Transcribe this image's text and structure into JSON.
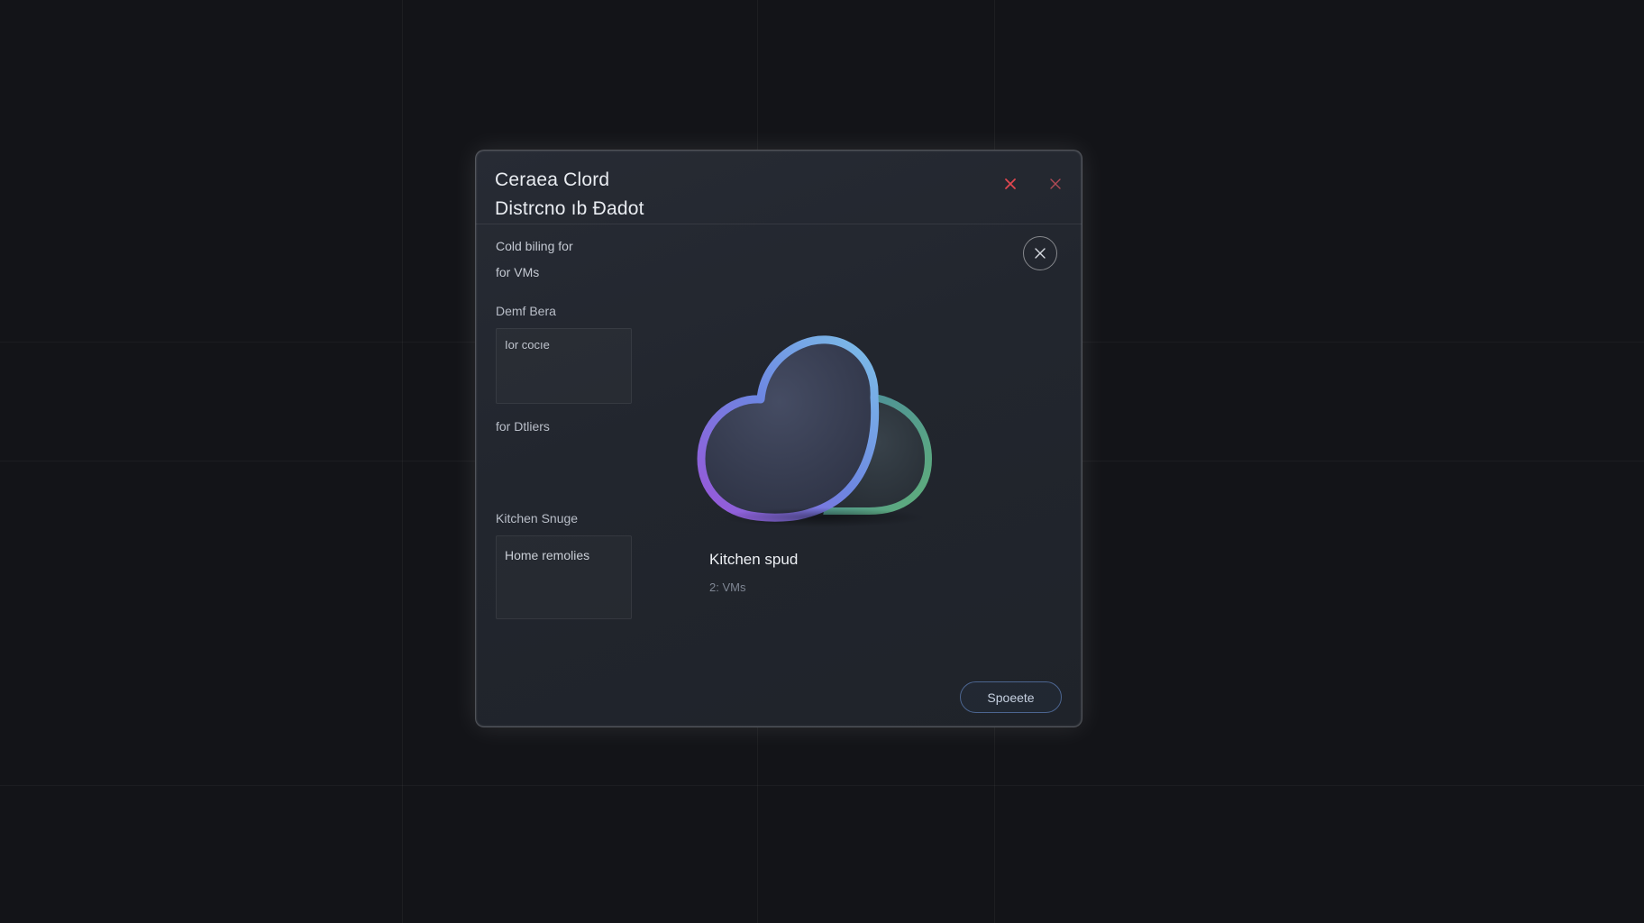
{
  "dialog": {
    "title_line1": "Ceraea Clord",
    "title_line2": "Distrcno ıb Ðadot",
    "header_close_red_icon": "close-icon",
    "header_close_icon": "close-icon",
    "circle_close_icon": "close-icon"
  },
  "sidebar": {
    "line1": "Cold biling for",
    "line2": "for VMs",
    "field1_label": "Demf Bera",
    "field1_value": "Ior cocıe",
    "text3": "for Dtliers",
    "field2_label": "Kitchen Snuge",
    "field2_value": "Home remolies"
  },
  "main": {
    "name": "Kitchen spud",
    "sub": "2: VMs",
    "action_label": "Spoeete"
  },
  "colors": {
    "background": "#131418",
    "panel": "#23272f",
    "red_close": "#e0474f",
    "button_border": "#4c6590",
    "cloud_gradient": [
      "#8a5bd6",
      "#5b8fe0",
      "#6fb4e6"
    ],
    "cloud_secondary": "#5aa27a"
  }
}
